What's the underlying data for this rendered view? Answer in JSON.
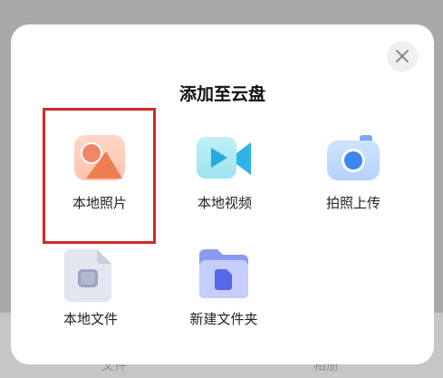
{
  "sheet": {
    "title": "添加至云盘",
    "close_icon": "close-icon"
  },
  "options": [
    {
      "label": "本地照片",
      "icon": "photo-icon",
      "selected": true
    },
    {
      "label": "本地视频",
      "icon": "video-icon"
    },
    {
      "label": "拍照上传",
      "icon": "camera-icon"
    },
    {
      "label": "本地文件",
      "icon": "file-icon"
    },
    {
      "label": "新建文件夹",
      "icon": "folder-icon"
    }
  ],
  "bottom_nav": {
    "left_label": "文件",
    "right_label": "相册"
  },
  "colors": {
    "highlight": "#d02a2a",
    "photo_accent": "#f28a66",
    "video_accent": "#39b8e6",
    "camera_accent": "#4a8ff0",
    "file_accent": "#9aa0b8",
    "folder_accent": "#6b7ff0"
  }
}
